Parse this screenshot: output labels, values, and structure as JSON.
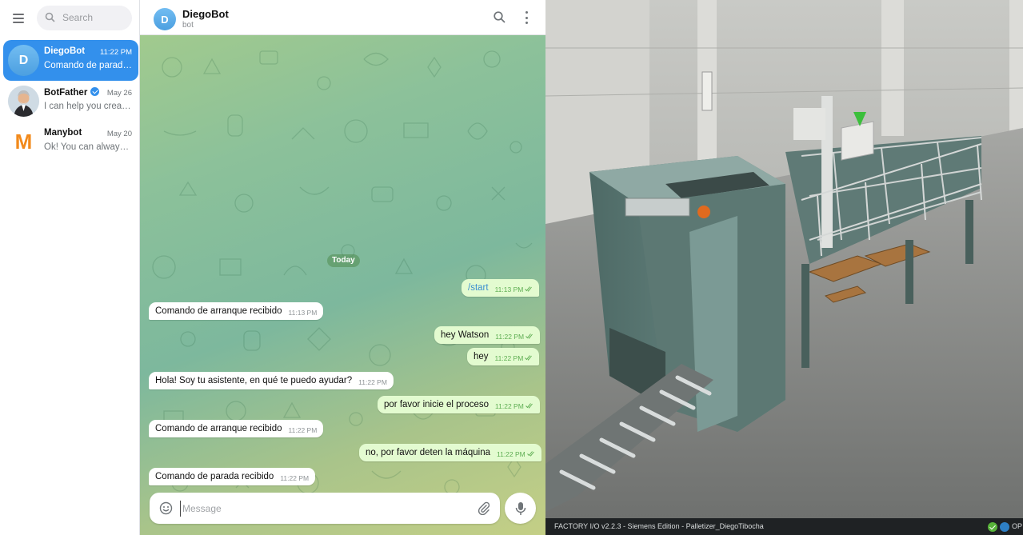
{
  "telegram": {
    "search_placeholder": "Search",
    "chats": [
      {
        "name": "DiegoBot",
        "initial": "D",
        "time": "11:22 PM",
        "preview": "Comando de parada recibido",
        "active": true,
        "verified": false
      },
      {
        "name": "BotFather",
        "initial": "",
        "time": "May 26",
        "preview": "I can help you create and manage Telegram bots.",
        "active": false,
        "verified": true
      },
      {
        "name": "Manybot",
        "initial": "M",
        "time": "May 20",
        "preview": "Ok! You can always come back.",
        "active": false,
        "verified": false
      }
    ],
    "header": {
      "name": "DiegoBot",
      "initial": "D",
      "status": "bot"
    },
    "date_divider": "Today",
    "messages": [
      {
        "dir": "out",
        "text": "/start",
        "time": "11:13 PM"
      },
      {
        "dir": "in",
        "text": "Comando de arranque recibido",
        "time": "11:13 PM"
      },
      {
        "dir": "out",
        "text": "hey Watson",
        "time": "11:22 PM"
      },
      {
        "dir": "out",
        "text": "hey",
        "time": "11:22 PM"
      },
      {
        "dir": "in",
        "text": "Hola! Soy tu asistente, en qué te puedo ayudar?",
        "time": "11:22 PM"
      },
      {
        "dir": "out",
        "text": "por favor inicie el proceso",
        "time": "11:22 PM"
      },
      {
        "dir": "in",
        "text": "Comando de arranque recibido",
        "time": "11:22 PM"
      },
      {
        "dir": "out",
        "text": "no, por favor deten la máquina",
        "time": "11:22 PM"
      },
      {
        "dir": "in",
        "text": "Comando de parada recibido",
        "time": "11:22 PM"
      }
    ],
    "composer_placeholder": "Message",
    "colors": {
      "accent": "#3390ec",
      "outgoing_bubble": "#e3fbd0",
      "incoming_bubble": "#ffffff",
      "manybot_orange": "#f28a1c"
    }
  },
  "factory_io": {
    "status_text": "FACTORY I/O v2.2.3 - Siemens Edition - Palletizer_DiegoTibocha",
    "status_right": "OP",
    "icons": [
      "check-circle-icon",
      "network-icon"
    ]
  }
}
